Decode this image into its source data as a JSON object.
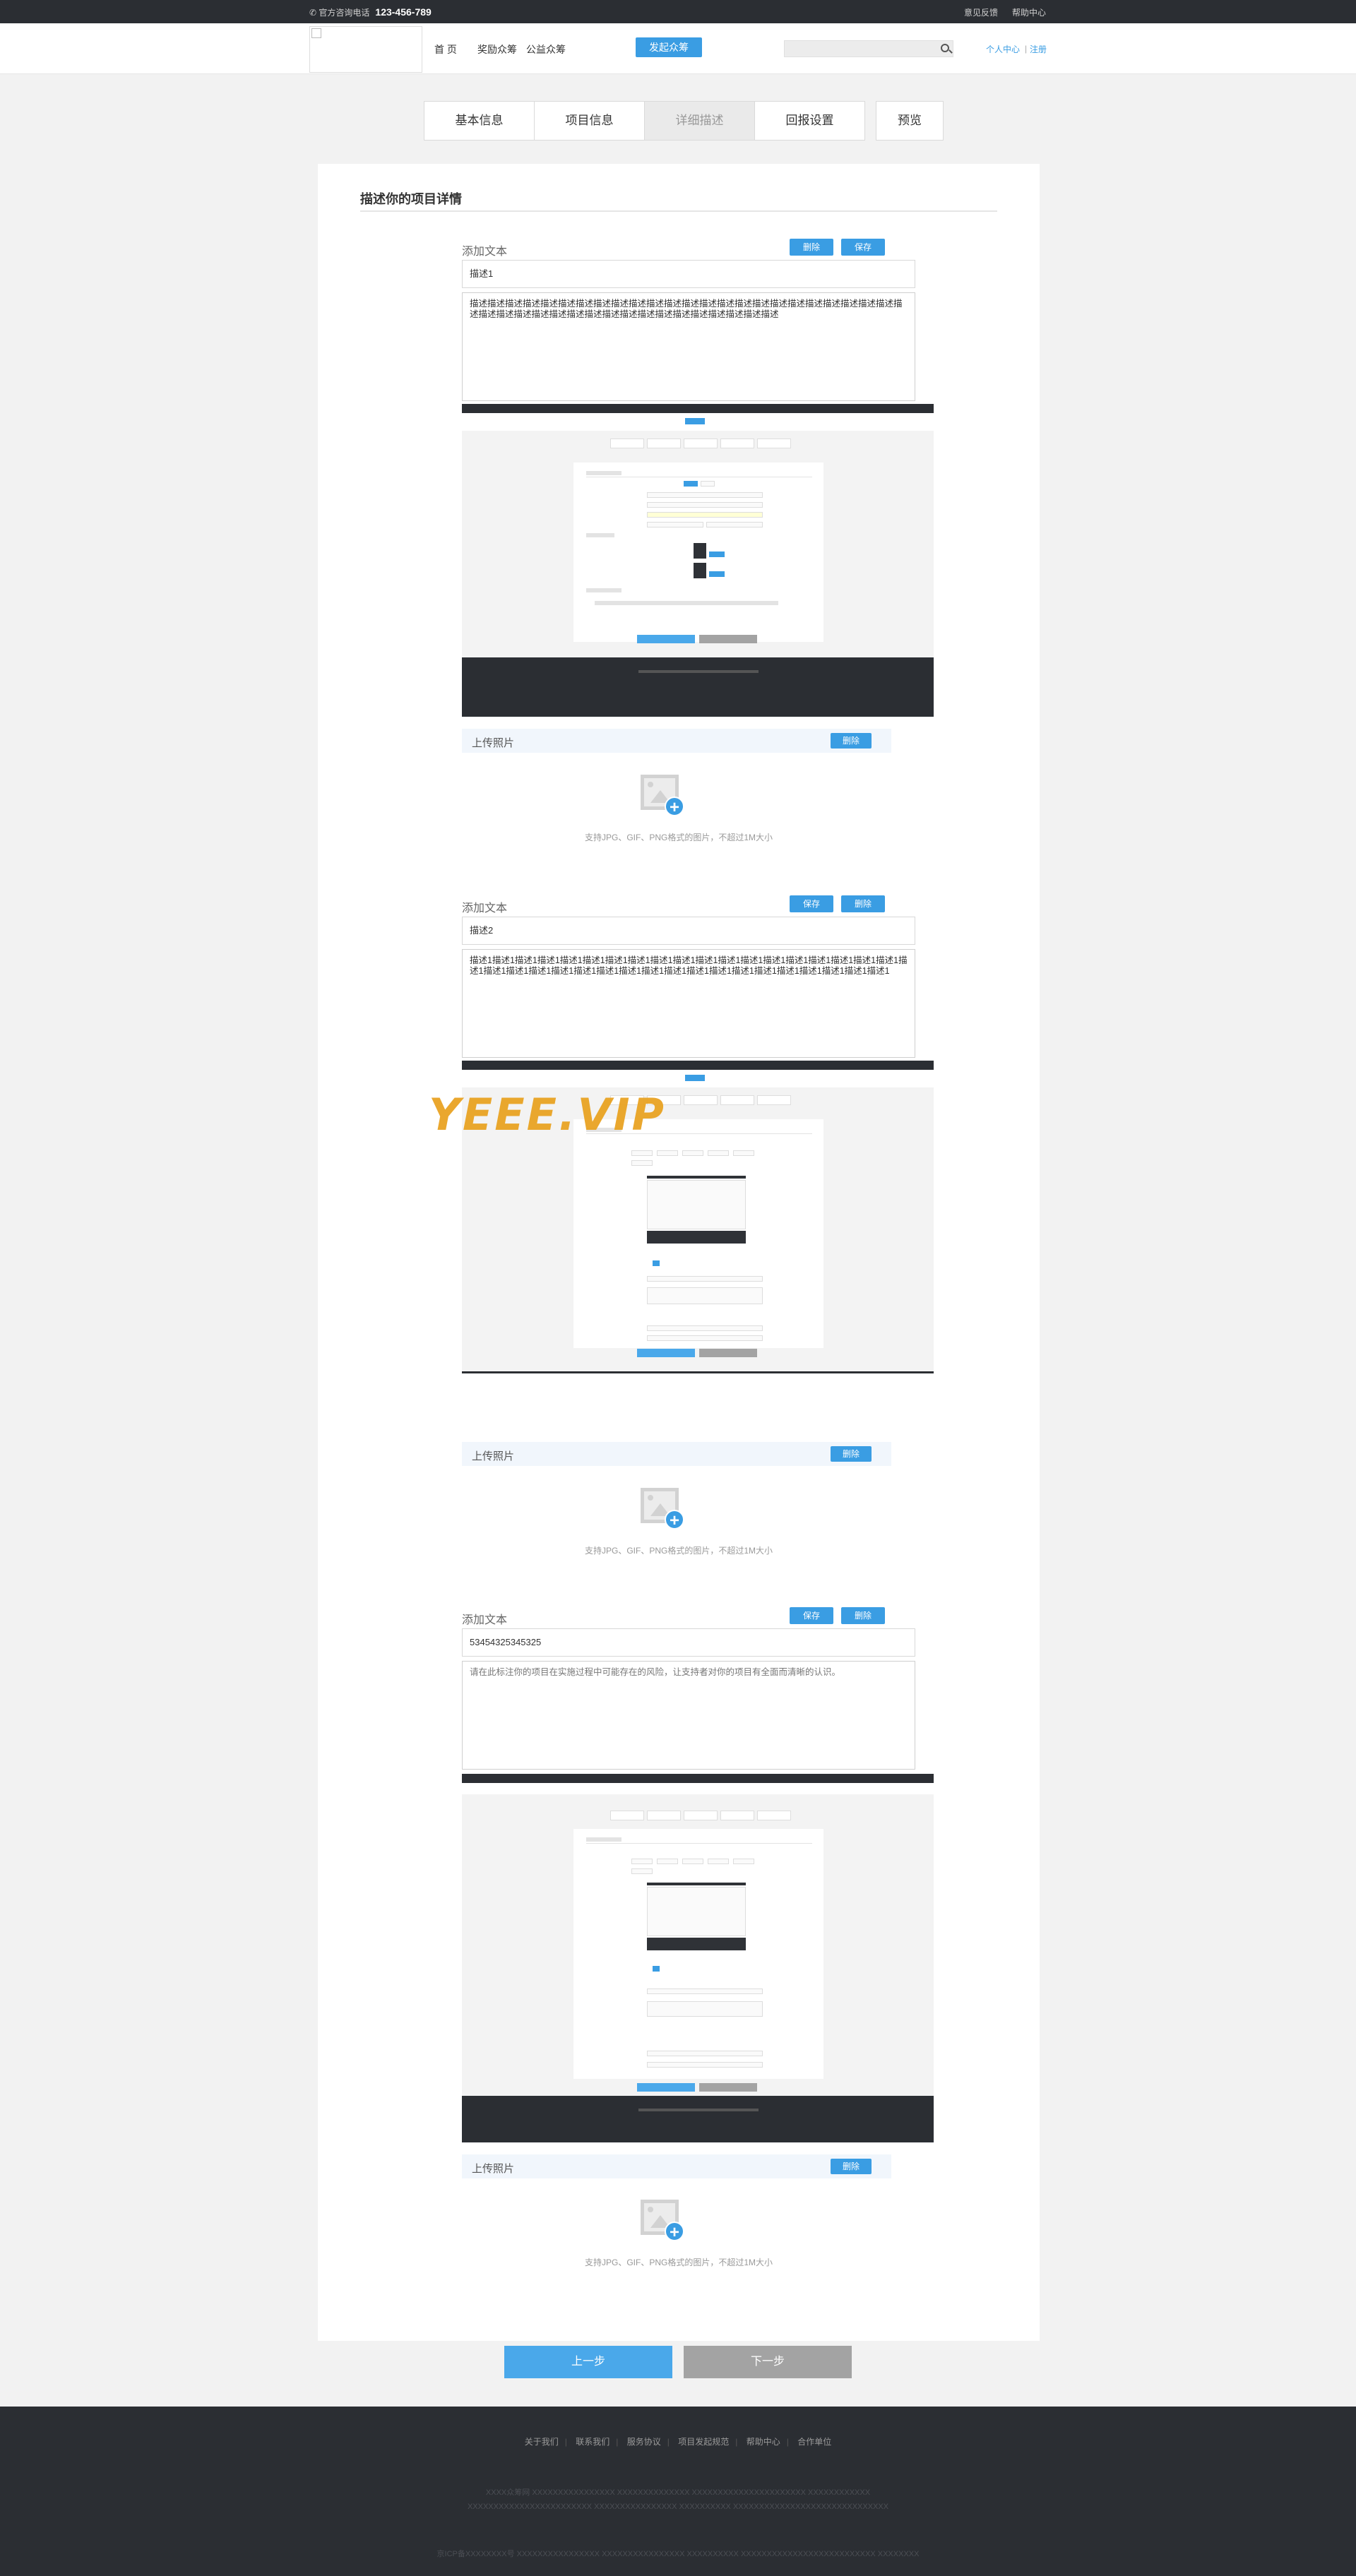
{
  "topbar": {
    "hotline_label": "官方咨询电话",
    "hotline_number": "123-456-789",
    "feedback": "意见反馈",
    "help": "帮助中心"
  },
  "header": {
    "nav": [
      "首 页",
      "奖励众筹",
      "公益众筹"
    ],
    "launch_button": "发起众筹",
    "search_placeholder": "",
    "user_center": "个人中心",
    "register": "注册"
  },
  "steps": [
    {
      "label": "基本信息"
    },
    {
      "label": "项目信息"
    },
    {
      "label": "详细描述"
    },
    {
      "label": "回报设置"
    },
    {
      "label": "预览"
    }
  ],
  "main": {
    "title": "描述你的项目详情",
    "sections": [
      {
        "add_text_label": "添加文本",
        "button_a": "删除",
        "button_b": "保存",
        "title_value": "描述1",
        "content": "描述描述描述描述描述描述描述描述描述描述描述描述描述描述描述描述描述描述描述描述描述描述描述描述描述描述描述描述描述描述描述描述描述描述描述描述描述描述描述描述描述描述",
        "upload_label": "上传照片",
        "upload_delete": "删除",
        "hint": "支持JPG、GIF、PNG格式的图片，不超过1M大小"
      },
      {
        "add_text_label": "添加文本",
        "button_a": "保存",
        "button_b": "删除",
        "title_value": "描述2",
        "content": "描述1描述1描述1描述1描述1描述1描述1描述1描述1描述1描述1描述1描述1描述1描述1描述1描述1描述1描述1描述1描述1描述1描述1描述1描述1描述1描述1描述1描述1描述1描述1描述1描述1描述1描述1描述1描述1描述1",
        "upload_label": "上传照片",
        "upload_delete": "删除",
        "hint": "支持JPG、GIF、PNG格式的图片，不超过1M大小"
      },
      {
        "add_text_label": "添加文本",
        "button_a": "保存",
        "button_b": "删除",
        "title_value": "53454325345325",
        "content": "请在此标注你的项目在实施过程中可能存在的风险，让支持者对你的项目有全面而清晰的认识。",
        "upload_label": "上传照片",
        "upload_delete": "删除",
        "hint": "支持JPG、GIF、PNG格式的图片，不超过1M大小"
      }
    ],
    "watermark": "YEEE.VIP"
  },
  "nav_buttons": {
    "prev": "上一步",
    "next": "下一步"
  },
  "footer": {
    "links": [
      "关于我们",
      "联系我们",
      "服务协议",
      "项目发起规范",
      "帮助中心",
      "合作单位"
    ],
    "description": "XXXX众筹网 XXXXXXXXXXXXXXXX XXXXXXXXXXXXXX XXXXXXXXXXXXXXXXXXXXXX XXXXXXXXXXXX XXXXXXXXXXXXXXXXXXXXXXXX XXXXXXXXXXXXXXXX XXXXXXXXXX XXXXXXXXXXXXXXXXXXXXXXXXXXXXXX",
    "copyright": "京ICP备XXXXXXXX号 XXXXXXXXXXXXXXXX XXXXXXXXXXXXXXXX XXXXXXXXXX XXXXXXXXXXXXXXXXXXXXXXXXXX XXXXXXXX"
  },
  "colors": {
    "accent": "#3a9de3",
    "topbar": "#2b2e33",
    "page_bg": "#f2f2f2",
    "next_gray": "#a3a3a3",
    "watermark": "#e9a323"
  }
}
